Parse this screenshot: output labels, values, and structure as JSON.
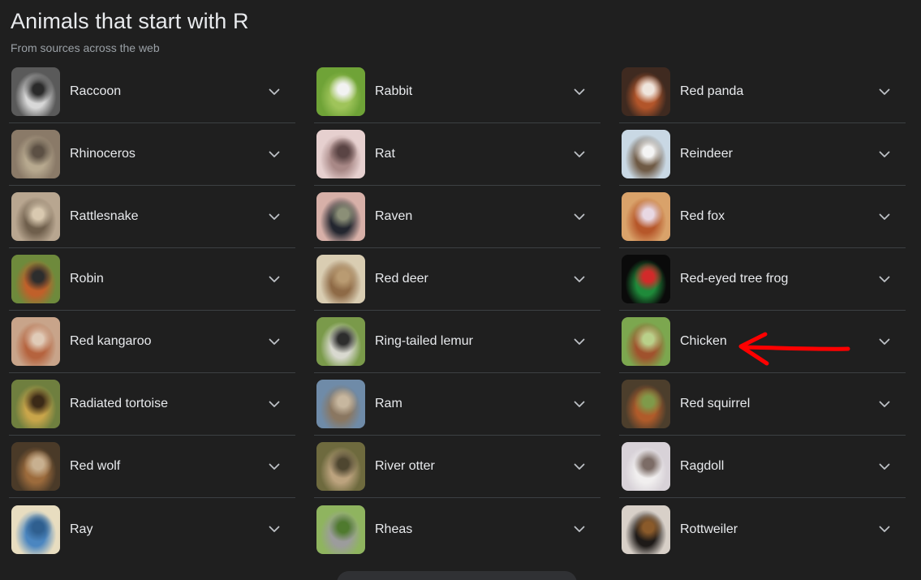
{
  "header": {
    "title": "Animals that start with R",
    "subtitle": "From sources across the web"
  },
  "columns": [
    {
      "items": [
        {
          "label": "Raccoon",
          "icon": "raccoon-image",
          "colors": [
            "#5a5a5a",
            "#d8d8d8",
            "#2a2a2a"
          ]
        },
        {
          "label": "Rhinoceros",
          "icon": "rhinoceros-image",
          "colors": [
            "#8a7a68",
            "#b7a98f",
            "#5c5044"
          ]
        },
        {
          "label": "Rattlesnake",
          "icon": "rattlesnake-image",
          "colors": [
            "#b8a690",
            "#6f5f4c",
            "#d9c9b0"
          ]
        },
        {
          "label": "Robin",
          "icon": "robin-image",
          "colors": [
            "#6e8a3c",
            "#c0602a",
            "#2d2d2d"
          ]
        },
        {
          "label": "Red kangaroo",
          "icon": "red-kangaroo-image",
          "colors": [
            "#c8a48a",
            "#b5633e",
            "#e0cbb8"
          ]
        },
        {
          "label": "Radiated tortoise",
          "icon": "radiated-tortoise-image",
          "colors": [
            "#6f7f3f",
            "#c9a54a",
            "#3b2a17"
          ]
        },
        {
          "label": "Red wolf",
          "icon": "red-wolf-image",
          "colors": [
            "#4a3a28",
            "#9c6b3c",
            "#c8b090"
          ]
        },
        {
          "label": "Ray",
          "icon": "ray-image",
          "colors": [
            "#e8ddc0",
            "#4b86c0",
            "#2f5f8f"
          ]
        }
      ]
    },
    {
      "items": [
        {
          "label": "Rabbit",
          "icon": "rabbit-image",
          "colors": [
            "#6fa337",
            "#9fc45a",
            "#f2f2f2"
          ]
        },
        {
          "label": "Rat",
          "icon": "rat-image",
          "colors": [
            "#e6d0cf",
            "#a88886",
            "#5a4444"
          ]
        },
        {
          "label": "Raven",
          "icon": "raven-image",
          "colors": [
            "#d7b0a8",
            "#23262f",
            "#8b8f77"
          ]
        },
        {
          "label": "Red deer",
          "icon": "red-deer-image",
          "colors": [
            "#d9cdb2",
            "#8e6a46",
            "#b99b72"
          ]
        },
        {
          "label": "Ring-tailed lemur",
          "icon": "ring-tailed-lemur-image",
          "colors": [
            "#7a9a4a",
            "#d9d9d0",
            "#2d2d2d"
          ]
        },
        {
          "label": "Ram",
          "icon": "ram-image",
          "colors": [
            "#6f8ba8",
            "#8a7761",
            "#c7b79f"
          ]
        },
        {
          "label": "River otter",
          "icon": "river-otter-image",
          "colors": [
            "#6e6a3e",
            "#bca37e",
            "#4e4630"
          ]
        },
        {
          "label": "Rheas",
          "icon": "rheas-image",
          "colors": [
            "#8fb45f",
            "#9c9c9c",
            "#4f7a2e"
          ]
        }
      ]
    },
    {
      "items": [
        {
          "label": "Red panda",
          "icon": "red-panda-image",
          "colors": [
            "#3f2a20",
            "#b2552a",
            "#efe5dd"
          ]
        },
        {
          "label": "Reindeer",
          "icon": "reindeer-image",
          "colors": [
            "#c9d8e4",
            "#6f5a45",
            "#f4f4f4"
          ]
        },
        {
          "label": "Red fox",
          "icon": "red-fox-image",
          "colors": [
            "#d9a26a",
            "#b6572a",
            "#e8d8e3"
          ]
        },
        {
          "label": "Red-eyed tree frog",
          "icon": "red-eyed-tree-frog-image",
          "colors": [
            "#0a0a0a",
            "#1f8a3a",
            "#d22a2a"
          ]
        },
        {
          "label": "Chicken",
          "icon": "chicken-image",
          "colors": [
            "#7ca74f",
            "#a0522d",
            "#b9d08a"
          ]
        },
        {
          "label": "Red squirrel",
          "icon": "red-squirrel-image",
          "colors": [
            "#4c3e2c",
            "#b05b2a",
            "#7f9a4a"
          ]
        },
        {
          "label": "Ragdoll",
          "icon": "ragdoll-image",
          "colors": [
            "#d8d2d8",
            "#f1efef",
            "#7c6c66"
          ]
        },
        {
          "label": "Rottweiler",
          "icon": "rottweiler-image",
          "colors": [
            "#d8d0c8",
            "#1e1a18",
            "#8a5a2a"
          ]
        }
      ]
    }
  ],
  "annotation": {
    "icon": "red-arrow-pointing-left",
    "color": "#ff0000"
  },
  "theme": {
    "background": "#1f1f1f",
    "divider": "#3c4043",
    "text": "#e8eaed",
    "muted": "#9aa0a6"
  }
}
